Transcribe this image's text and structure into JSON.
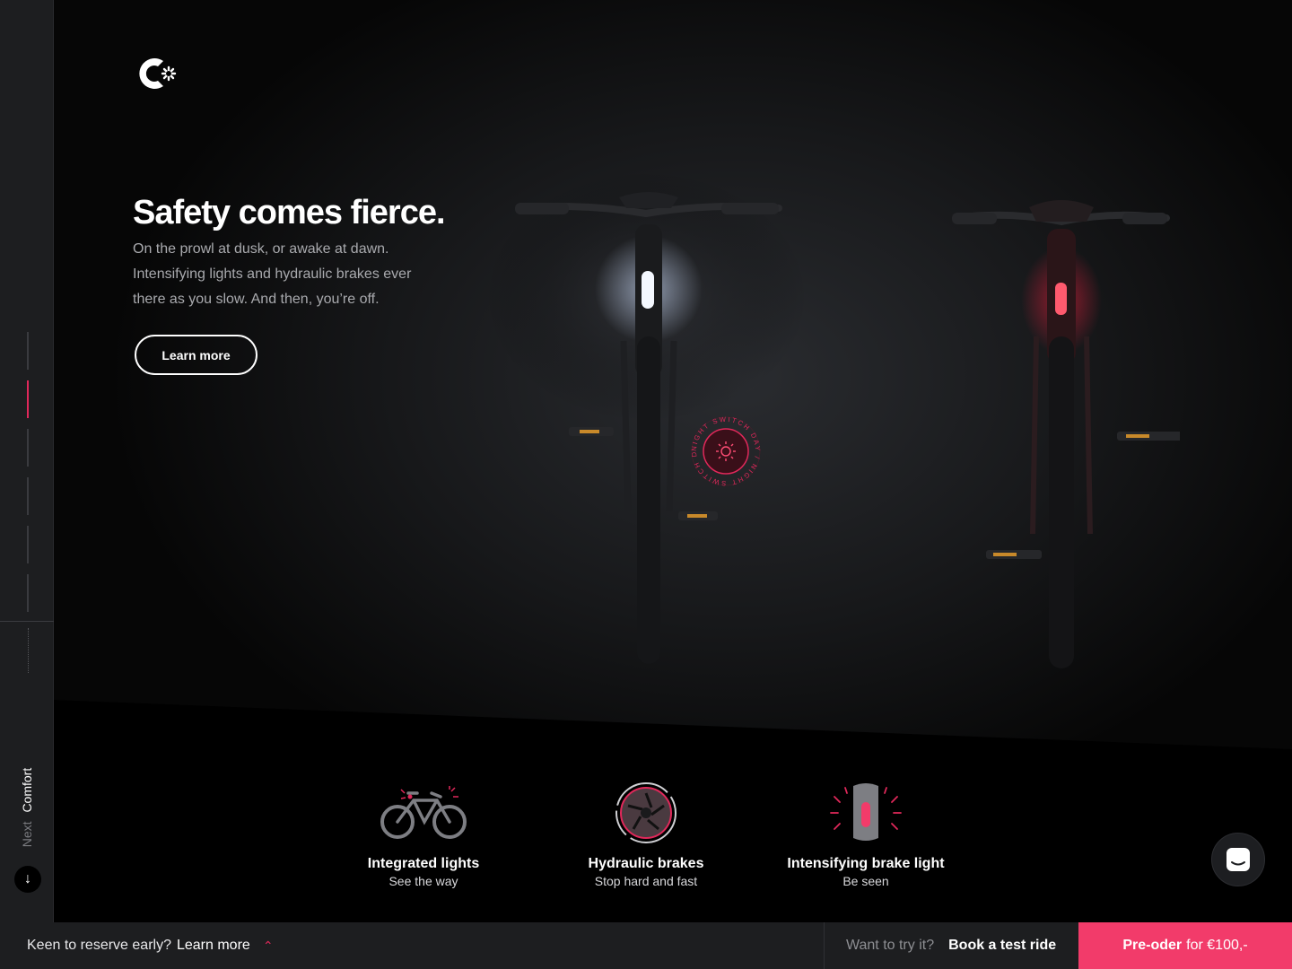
{
  "rail": {
    "next_label": "Next",
    "next_section": "Comfort",
    "arrow_icon": "arrow-down-icon"
  },
  "hero": {
    "title": "Safety comes fierce.",
    "description": "On the prowl at dusk, or awake at dawn. Intensifying lights and hydraulic brakes ever there as you slow. And then, you’re off.",
    "cta_label": "Learn more"
  },
  "badge": {
    "ring_text": "NIGHT SWITCH DAY / NIGHT SWITCH DAY /",
    "icon": "sun-icon"
  },
  "features": [
    {
      "title": "Integrated lights",
      "subtitle": "See the way",
      "icon": "bike-lights-icon"
    },
    {
      "title": "Hydraulic brakes",
      "subtitle": "Stop hard and fast",
      "icon": "brake-disc-icon"
    },
    {
      "title": "Intensifying brake light",
      "subtitle": "Be seen",
      "icon": "brake-light-icon"
    }
  ],
  "chat": {
    "icon": "chat-icon"
  },
  "bottom_bar": {
    "reserve_question": "Keen to reserve early?",
    "reserve_link": "Learn more",
    "try_question": "Want to try it?",
    "test_ride": "Book a test ride",
    "preorder_bold": "Pre-oder",
    "preorder_rest": "for €100,-"
  },
  "colors": {
    "accent": "#f23b6a",
    "accent_dark": "#e0285a",
    "rail_bg": "#1d1e20",
    "page_bg": "#000000"
  }
}
